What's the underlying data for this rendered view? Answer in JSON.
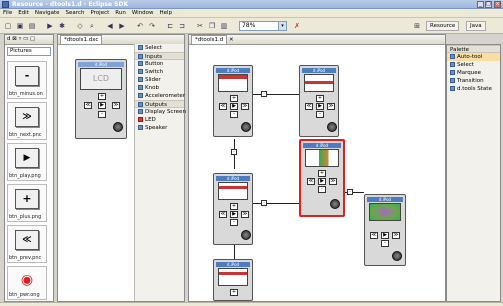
{
  "window": {
    "title": "Resource - dtools1.d - Eclipse SDK",
    "min": "_",
    "max": "□",
    "close": "x"
  },
  "menu": [
    "File",
    "Edit",
    "Navigate",
    "Search",
    "Project",
    "Run",
    "Window",
    "Help"
  ],
  "toolbar": {
    "zoom": "78%",
    "perspective_resource": "Resource",
    "perspective_java": "Java"
  },
  "left_view": {
    "tab": "d",
    "dropdown": "Pictures",
    "items": [
      "btn_minus.on",
      "btn_next.pnc",
      "btn_play.png",
      "btn_plus.png",
      "btn_prev.pnc",
      "btn_pwr.ong"
    ]
  },
  "editor_a": {
    "tab": "*dtools1.dxc",
    "device_label": "d.iPod",
    "screen_text": "LCD"
  },
  "palette_a": {
    "header": "Palette",
    "items": [
      {
        "label": "Select",
        "header": false
      },
      {
        "label": "Inputs",
        "header": true
      },
      {
        "label": "Button",
        "header": false
      },
      {
        "label": "Switch",
        "header": false
      },
      {
        "label": "Slider",
        "header": false
      },
      {
        "label": "Knob",
        "header": false
      },
      {
        "label": "Accelerometer",
        "header": false
      },
      {
        "label": "Outputs",
        "header": true
      },
      {
        "label": "Display Screen",
        "header": false
      },
      {
        "label": "LED",
        "header": false
      },
      {
        "label": "Speaker",
        "header": false
      }
    ]
  },
  "editor_b": {
    "tab": "*dtools1.d",
    "device_label": "d.iPod"
  },
  "palette_b": {
    "header": "Palette",
    "items": [
      "Auto-tool",
      "Select",
      "Marquee",
      "Transition",
      "d.tools State"
    ]
  }
}
